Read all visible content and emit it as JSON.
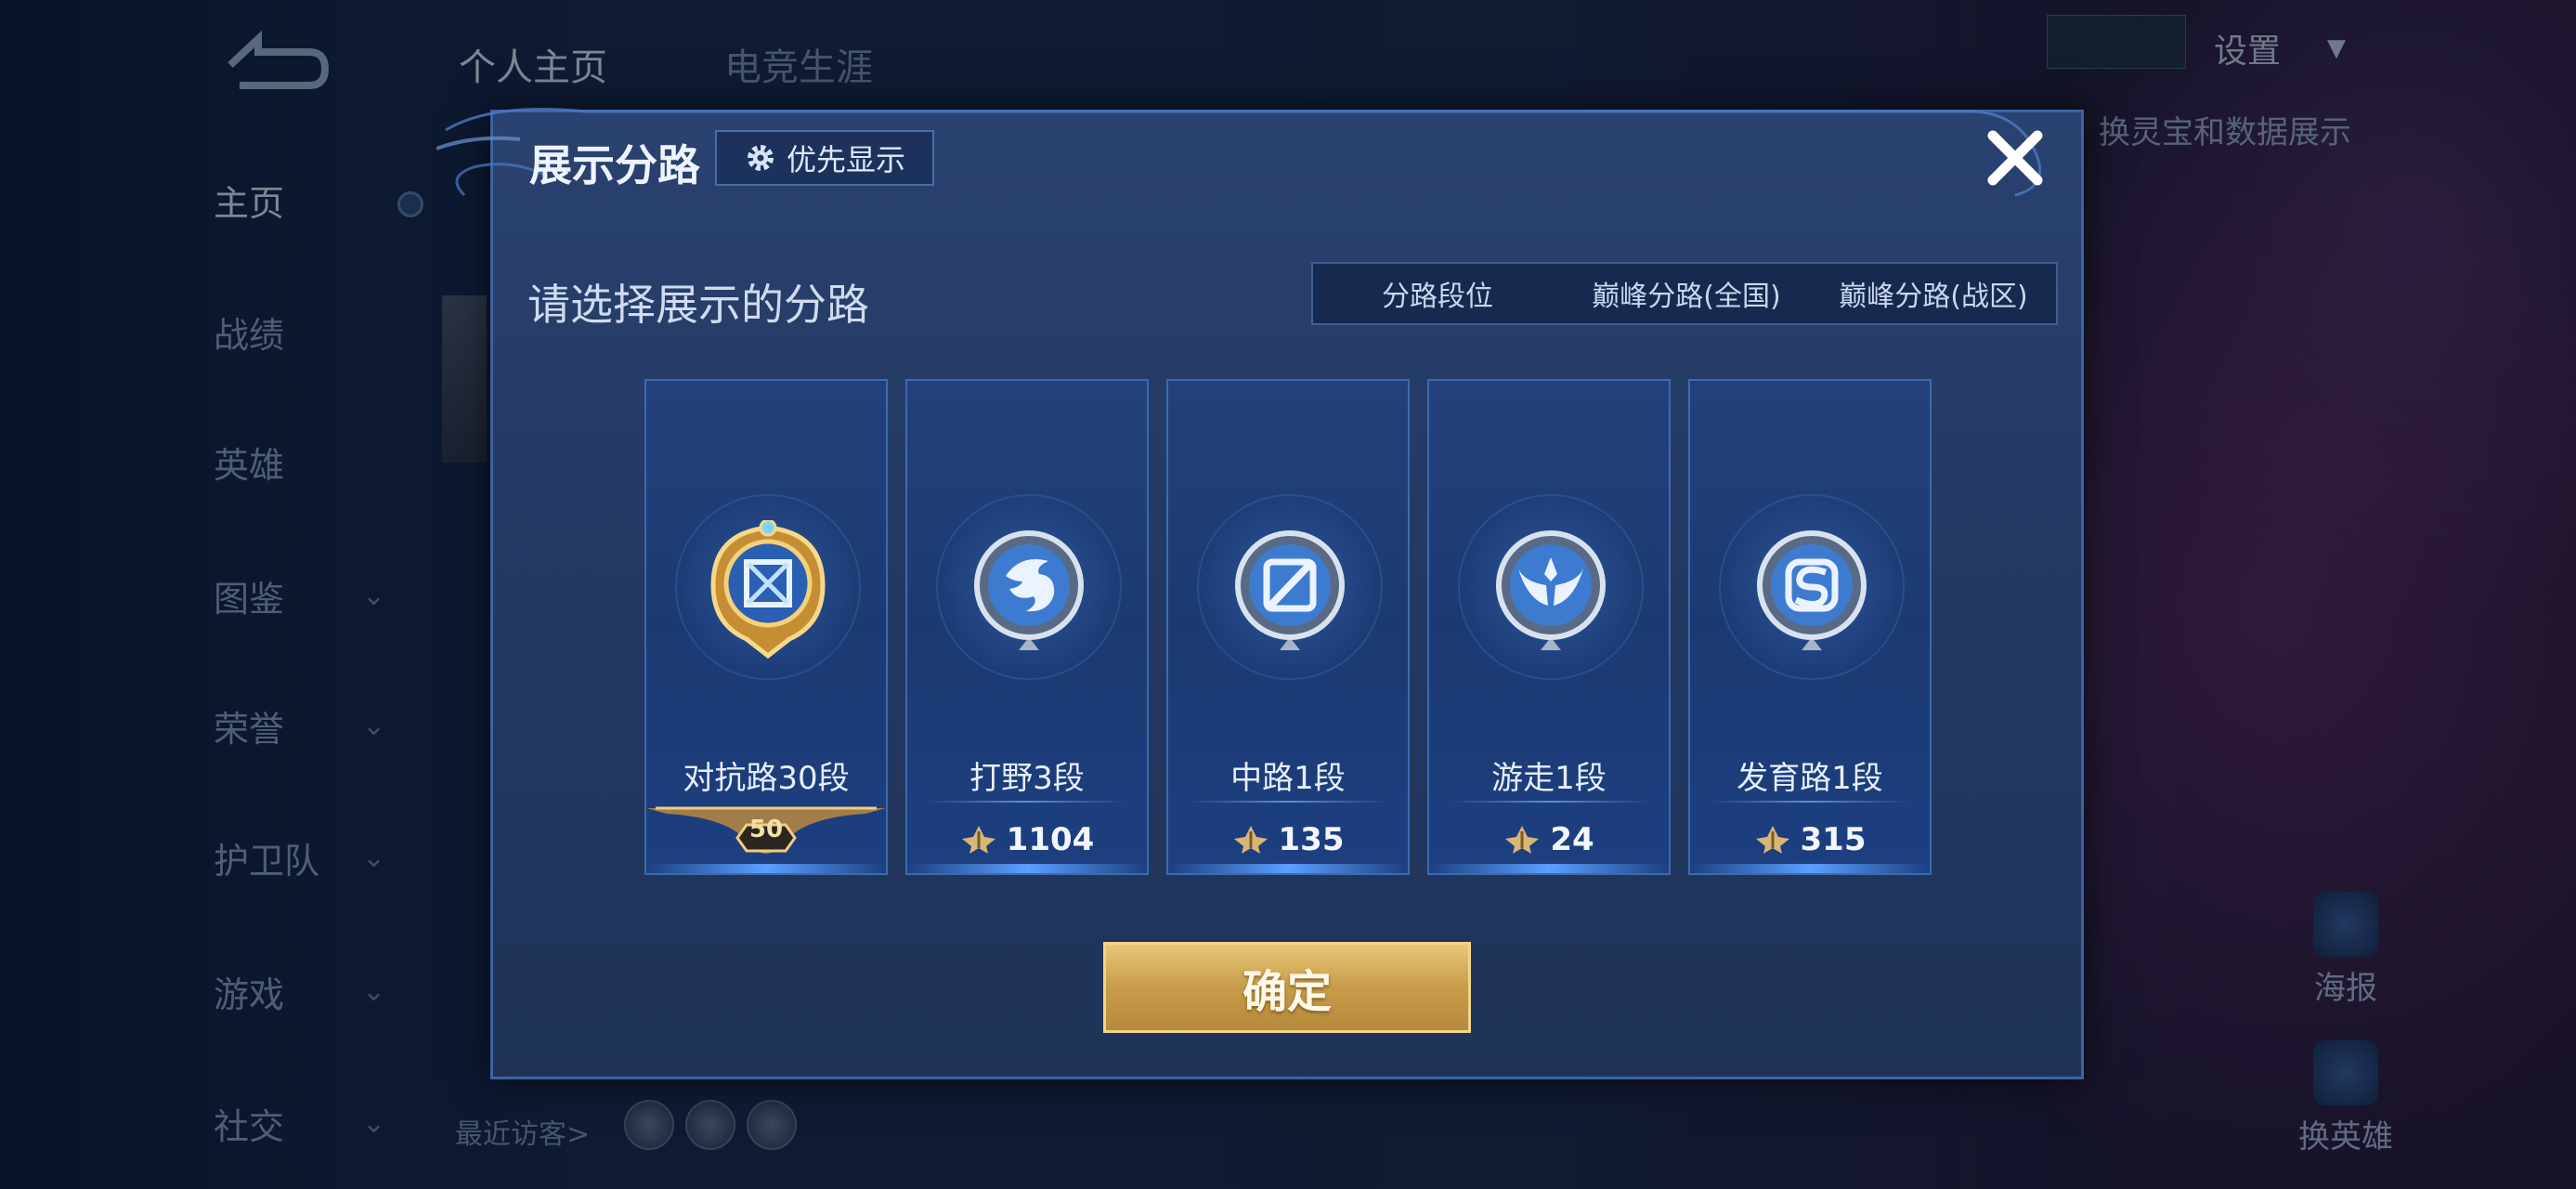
{
  "background": {
    "top_tabs": [
      "个人主页",
      "电竞生涯"
    ],
    "sidebar_items": [
      {
        "label": "主页",
        "active": true,
        "chevron": false
      },
      {
        "label": "战绩",
        "active": false,
        "chevron": false
      },
      {
        "label": "英雄",
        "active": false,
        "chevron": false
      },
      {
        "label": "图鉴",
        "active": false,
        "chevron": true
      },
      {
        "label": "荣誉",
        "active": false,
        "chevron": true
      },
      {
        "label": "护卫队",
        "active": false,
        "chevron": true
      },
      {
        "label": "游戏",
        "active": false,
        "chevron": true
      },
      {
        "label": "社交",
        "active": false,
        "chevron": true
      }
    ],
    "settings_label": "设置",
    "settings_subtext": "换灵宝和数据展示",
    "recent_visitors_label": "最近访客>",
    "right_items": [
      {
        "label": "海报",
        "icon": "poster-icon"
      },
      {
        "label": "换英雄",
        "icon": "swap-hero-icon"
      }
    ]
  },
  "dialog": {
    "title": "展示分路",
    "priority_button_label": "优先显示",
    "subtitle": "请选择展示的分路",
    "tabs": [
      {
        "label": "分路段位",
        "active": true
      },
      {
        "label": "巅峰分路(全国)",
        "active": false
      },
      {
        "label": "巅峰分路(战区)",
        "active": false
      }
    ],
    "cards": [
      {
        "name": "对抗路30段",
        "emblem": "clash-lane-gold-emblem-icon",
        "level_badge": "50",
        "score": null
      },
      {
        "name": "打野3段",
        "emblem": "jungle-dragon-emblem-icon",
        "level_badge": null,
        "score": "1104"
      },
      {
        "name": "中路1段",
        "emblem": "mid-lane-emblem-icon",
        "level_badge": null,
        "score": "135"
      },
      {
        "name": "游走1段",
        "emblem": "roam-wings-emblem-icon",
        "level_badge": null,
        "score": "24"
      },
      {
        "name": "发育路1段",
        "emblem": "farm-lane-emblem-icon",
        "level_badge": null,
        "score": "315"
      }
    ],
    "confirm_label": "确定"
  },
  "colors": {
    "accent_blue": "#2f63b6",
    "gold": "#d4a85a",
    "panel": "#243a64"
  }
}
